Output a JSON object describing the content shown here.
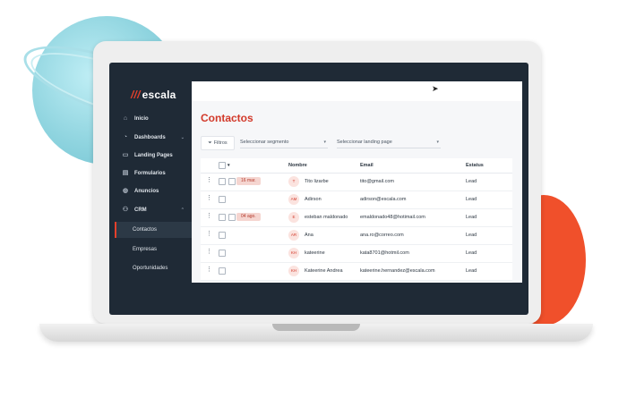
{
  "brand": {
    "logo_text": "escala",
    "logo_mark": "///"
  },
  "sidebar": {
    "items": [
      {
        "label": "Inicio",
        "icon": "home-icon"
      },
      {
        "label": "Dashboards",
        "icon": "dashboard-icon",
        "chevron": "⌄"
      },
      {
        "label": "Landing Pages",
        "icon": "landing-icon"
      },
      {
        "label": "Formularios",
        "icon": "form-icon"
      },
      {
        "label": "Anuncios",
        "icon": "globe-icon"
      },
      {
        "label": "CRM",
        "icon": "users-icon",
        "chevron": "⌃"
      }
    ],
    "sub_items": [
      {
        "label": "Contactos",
        "active": true
      },
      {
        "label": "Empresas",
        "active": false
      },
      {
        "label": "Oportunidades",
        "active": false
      }
    ]
  },
  "page": {
    "title": "Contactos"
  },
  "toolbar": {
    "filter_label": "Filtros",
    "segment_placeholder": "Seleccionar segmento",
    "landing_placeholder": "Seleccionar landing page"
  },
  "table": {
    "columns": [
      "Nombre",
      "Email",
      "Estatus"
    ],
    "rows": [
      {
        "menu": "⋮",
        "badge": "16 mar.",
        "initials": "T",
        "name": "Tito lizarbe",
        "email": "tito@gmail.com",
        "status": "Lead"
      },
      {
        "menu": "⋮",
        "badge": "",
        "initials": "AM",
        "name": "Adirson",
        "email": "adirson@escala.com",
        "status": "Lead"
      },
      {
        "menu": "⋮",
        "badge": "04 ago.",
        "initials": "E",
        "name": "esteban maldonado",
        "email": "emaldonado48@hotimail.com",
        "status": "Lead"
      },
      {
        "menu": "⋮",
        "badge": "",
        "initials": "AR",
        "name": "Ana",
        "email": "ana.ro@correo.com",
        "status": "Lead"
      },
      {
        "menu": "⋮",
        "badge": "",
        "initials": "KH",
        "name": "kateerine",
        "email": "kata8701@hotmil.com",
        "status": "Lead"
      },
      {
        "menu": "⋮",
        "badge": "",
        "initials": "KH",
        "name": "Kateerine Andrea",
        "email": "kateerine.hernandez@escala.com",
        "status": "Lead"
      }
    ]
  },
  "colors": {
    "accent": "#d2392a",
    "sidebar_bg": "#1f2a36",
    "decor_orange": "#f0502b",
    "decor_teal": "#8fd4df"
  }
}
